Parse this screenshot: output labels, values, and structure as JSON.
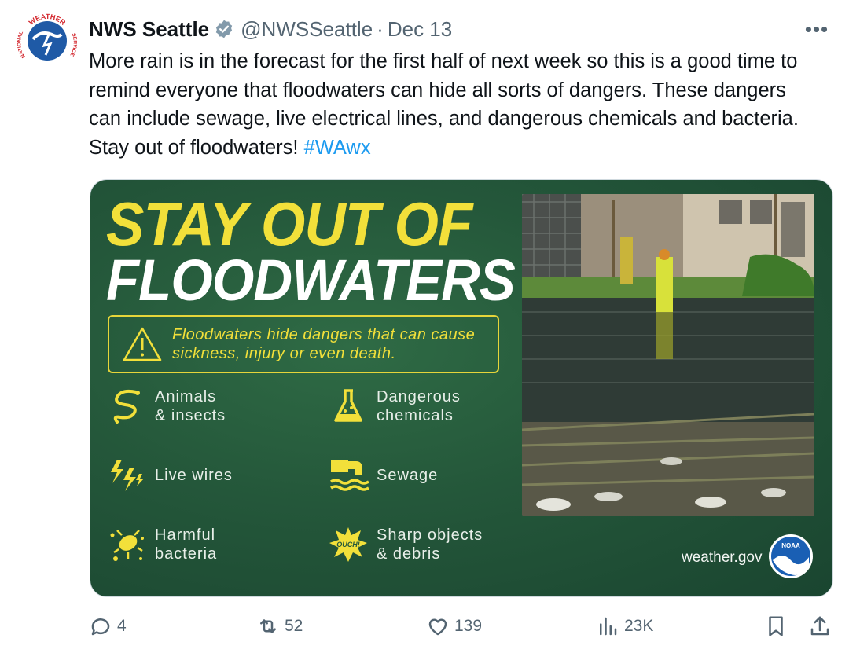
{
  "tweet": {
    "author_name": "NWS Seattle",
    "handle": "@NWSSeattle",
    "separator": "·",
    "date": "Dec 13",
    "more_label": "•••",
    "text": "More rain is in the forecast for the first half of next week so this is a good time to remind everyone that floodwaters can hide all sorts of dangers. These dangers can include sewage, live electrical lines, and dangerous chemicals and bacteria. Stay out of floodwaters!",
    "hashtag": "#WAwx"
  },
  "avatar": {
    "logo_text_top": "WEATHER",
    "logo_text_left": "NATIONAL",
    "logo_text_right": "SERVICE"
  },
  "card": {
    "title_line1": "STAY OUT OF",
    "title_line2": "FLOODWATERS",
    "warning_text": "Floodwaters hide dangers that can cause sickness, injury or even death.",
    "hazards": [
      {
        "icon": "snake-icon",
        "label": "Animals\n& insects"
      },
      {
        "icon": "flask-icon",
        "label": "Dangerous\nchemicals"
      },
      {
        "icon": "lightning-icon",
        "label": "Live wires"
      },
      {
        "icon": "sewage-pipe-icon",
        "label": "Sewage"
      },
      {
        "icon": "bacteria-icon",
        "label": "Harmful\nbacteria"
      },
      {
        "icon": "ouch-icon",
        "label": "Sharp objects\n& debris"
      }
    ],
    "ouch_text": "OUCH!",
    "website": "weather.gov",
    "noaa_text": "NOAA"
  },
  "actions": {
    "replies": "4",
    "reposts": "52",
    "likes": "139",
    "views": "23K"
  },
  "colors": {
    "accent": "#1d9bf0",
    "card_green": "#24573a",
    "card_yellow": "#f2e03a",
    "muted": "#536471"
  }
}
